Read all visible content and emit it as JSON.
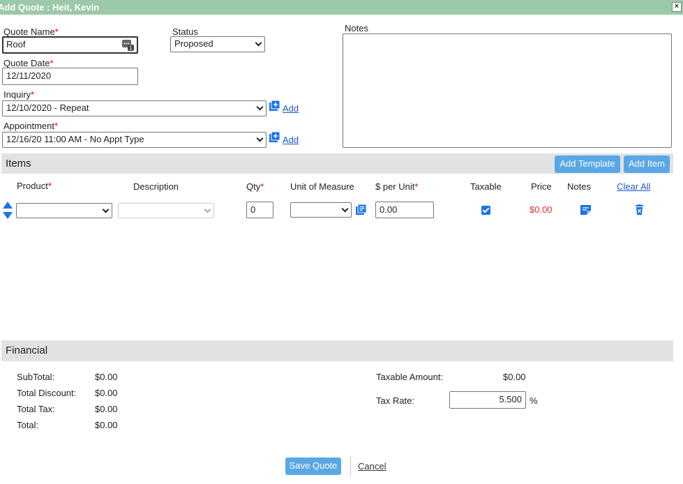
{
  "window": {
    "title": "Add Quote : Heit, Kevin"
  },
  "form": {
    "quote_name_label": "Quote Name",
    "quote_name_value": "Roof",
    "status_label": "Status",
    "status_value": "Proposed",
    "quote_date_label": "Quote Date",
    "quote_date_value": "12/11/2020",
    "inquiry_label": "Inquiry",
    "inquiry_value": "12/10/2020 - Repeat",
    "appointment_label": "Appointment",
    "appointment_value": "12/16/20 11:00 AM - No Appt Type",
    "add_label": "Add",
    "notes_label": "Notes",
    "required_mark": "*"
  },
  "items": {
    "title": "Items",
    "add_template_label": "Add Template",
    "add_item_label": "Add Item",
    "columns": {
      "product": "Product",
      "description": "Description",
      "qty": "Qty",
      "unit": "Unit of Measure",
      "per_unit": "$ per Unit",
      "taxable": "Taxable",
      "price": "Price",
      "notes": "Notes",
      "clear_all": "Clear All"
    },
    "row": {
      "qty": "0",
      "per_unit": "0.00",
      "taxable": true,
      "price": "$0.00"
    }
  },
  "financial": {
    "title": "Financial",
    "subtotal_label": "SubTotal:",
    "subtotal_value": "$0.00",
    "discount_label": "Total Discount:",
    "discount_value": "$0.00",
    "tax_label": "Total Tax:",
    "tax_value": "$0.00",
    "total_label": "Total:",
    "total_value": "$0.00",
    "taxable_amount_label": "Taxable Amount:",
    "taxable_amount_value": "$0.00",
    "tax_rate_label": "Tax Rate:",
    "tax_rate_value": "5.500",
    "percent": "%"
  },
  "footer": {
    "save_label": "Save Quote",
    "cancel_label": "Cancel"
  },
  "colors": {
    "accent": "#5aa7e6",
    "title_bar": "#9cc9a8",
    "required": "#d00000",
    "link": "#1e57c4"
  }
}
